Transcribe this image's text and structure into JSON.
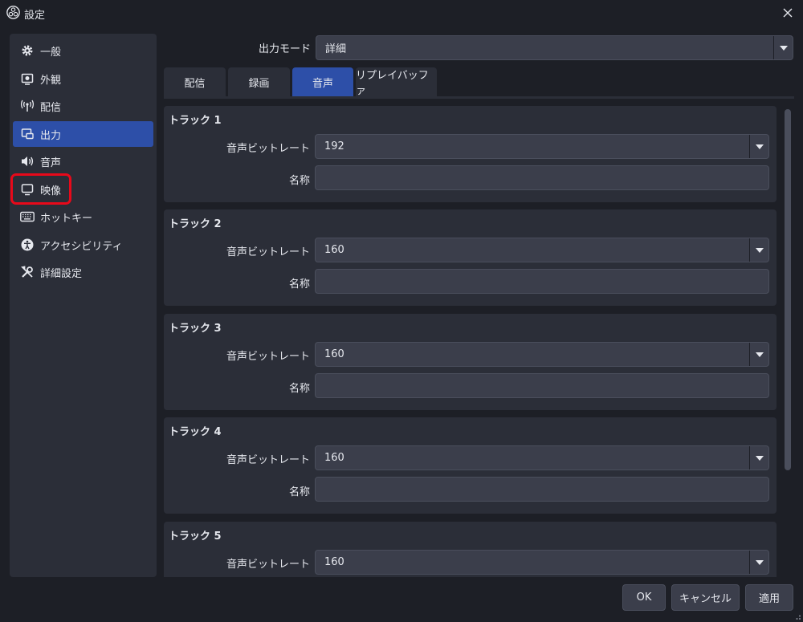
{
  "window": {
    "title": "設定"
  },
  "sidebar": {
    "items": [
      {
        "label": "一般",
        "icon": "gear-icon"
      },
      {
        "label": "外観",
        "icon": "appearance-icon"
      },
      {
        "label": "配信",
        "icon": "antenna-icon"
      },
      {
        "label": "出力",
        "icon": "output-icon"
      },
      {
        "label": "音声",
        "icon": "speaker-icon"
      },
      {
        "label": "映像",
        "icon": "monitor-icon"
      },
      {
        "label": "ホットキー",
        "icon": "keyboard-icon"
      },
      {
        "label": "アクセシビリティ",
        "icon": "accessibility-icon"
      },
      {
        "label": "詳細設定",
        "icon": "tools-icon"
      }
    ],
    "active_index": 3
  },
  "output_mode": {
    "label": "出力モード",
    "value": "詳細"
  },
  "tabs": [
    {
      "label": "配信"
    },
    {
      "label": "録画"
    },
    {
      "label": "音声"
    },
    {
      "label": "リプレイバッファ"
    }
  ],
  "active_tab": 2,
  "tracks": [
    {
      "title": "トラック 1",
      "bitrate_label": "音声ビットレート",
      "bitrate": "192",
      "name_label": "名称",
      "name": ""
    },
    {
      "title": "トラック 2",
      "bitrate_label": "音声ビットレート",
      "bitrate": "160",
      "name_label": "名称",
      "name": ""
    },
    {
      "title": "トラック 3",
      "bitrate_label": "音声ビットレート",
      "bitrate": "160",
      "name_label": "名称",
      "name": ""
    },
    {
      "title": "トラック 4",
      "bitrate_label": "音声ビットレート",
      "bitrate": "160",
      "name_label": "名称",
      "name": ""
    },
    {
      "title": "トラック 5",
      "bitrate_label": "音声ビットレート",
      "bitrate": "160",
      "name_label": "名称",
      "name": ""
    }
  ],
  "buttons": {
    "ok": "OK",
    "cancel": "キャンセル",
    "apply": "適用"
  },
  "colors": {
    "accent": "#2d4fa8",
    "highlight": "#e8091a",
    "panel": "#2b2e38",
    "background": "#1d1f26",
    "input": "#3b3e4b"
  }
}
